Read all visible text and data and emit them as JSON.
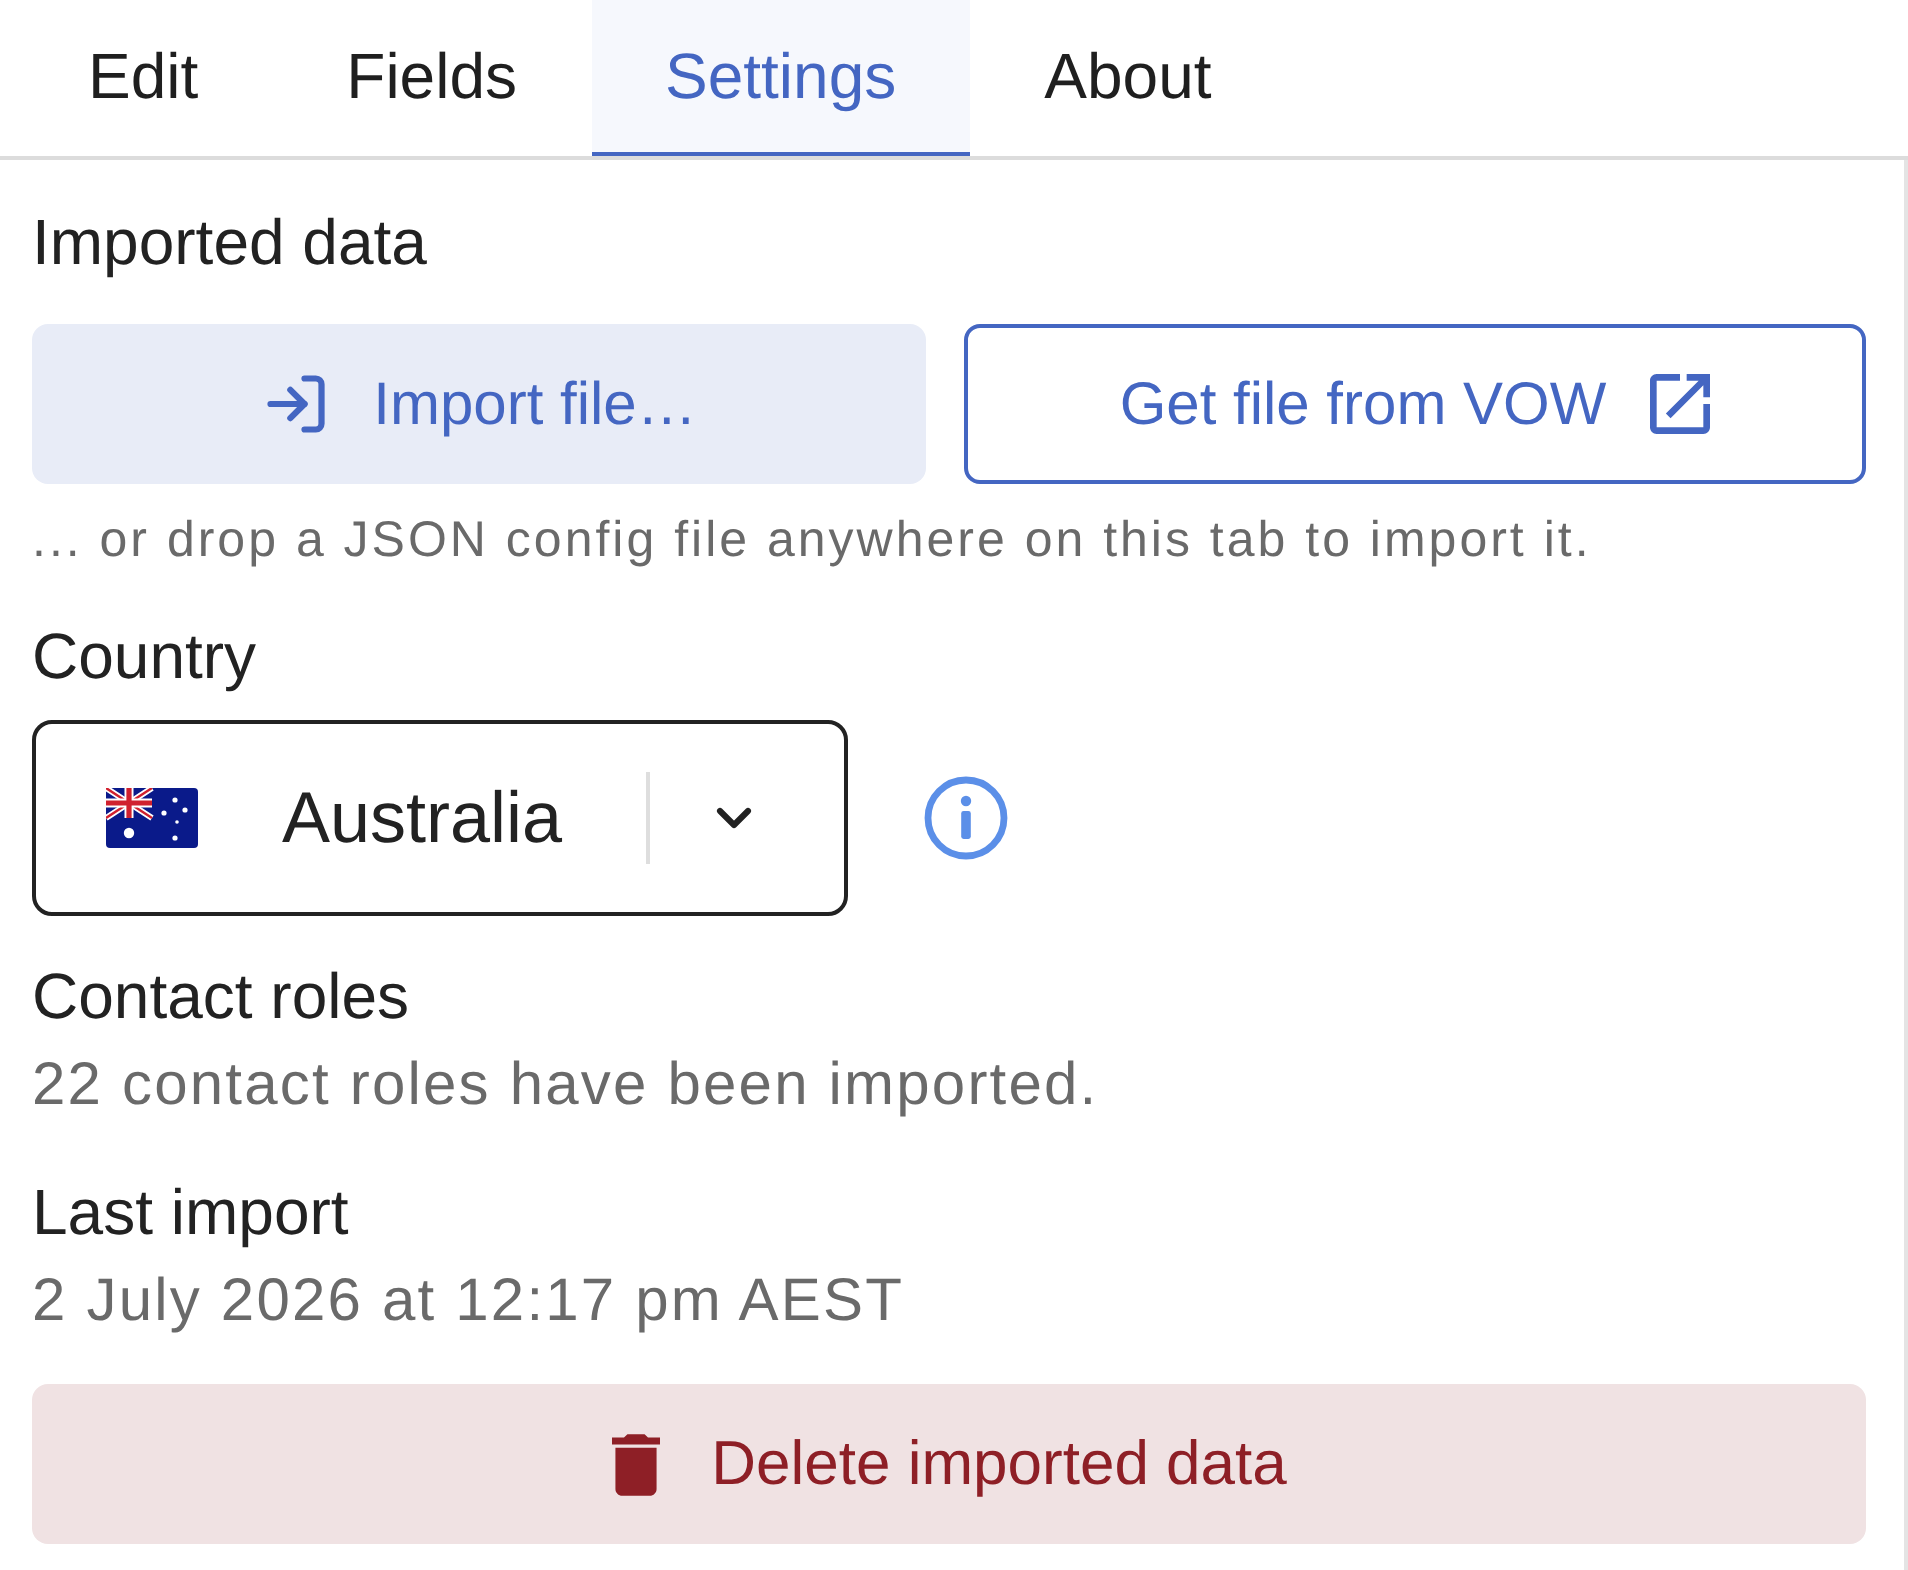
{
  "tabs": [
    {
      "label": "Edit",
      "selected": false
    },
    {
      "label": "Fields",
      "selected": false
    },
    {
      "label": "Settings",
      "selected": true
    },
    {
      "label": "About",
      "selected": false
    }
  ],
  "imported_data": {
    "heading": "Imported data",
    "buttons": [
      {
        "kind": "import",
        "label": "Import file…"
      },
      {
        "kind": "external",
        "label": "Get file from VOW"
      }
    ],
    "hint": "... or drop a JSON config file anywhere on this tab to import it."
  },
  "country": {
    "label": "Country",
    "value": "Australia"
  },
  "contact_roles": {
    "heading": "Contact roles",
    "text": "22 contact roles have been imported."
  },
  "last_import": {
    "heading": "Last import",
    "text": "2 July 2026 at 12:17 pm AEST"
  },
  "delete_button": {
    "label": "Delete imported data"
  }
}
